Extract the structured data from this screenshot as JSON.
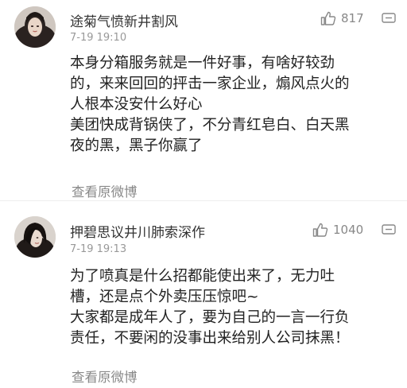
{
  "comments": [
    {
      "username": "途菊气愤新井割风",
      "timestamp": "7-19 19:10",
      "likes": "817",
      "lines": [
        "本身分箱服务就是一件好事，有啥好较劲",
        "的，来来回回的抨击一家企业，煽风点火的",
        "人根本没安什么好心",
        "美团快成背锅侠了，不分青红皂白、白天黑",
        "夜的黑，黑子你赢了"
      ],
      "view_link": "查看原微博"
    },
    {
      "username": "押碧思议井川肺索深作",
      "timestamp": "7-19 19:13",
      "likes": "1040",
      "lines": [
        "为了喷真是什么招都能使出来了，无力吐",
        "槽，还是点个外卖压压惊吧~",
        "大家都是成年人了，要为自己的一言一行负",
        "责任，不要闲的没事出来给别人公司抹黑！"
      ],
      "view_link": "查看原微博"
    }
  ],
  "icons": {
    "like": "thumbs-up-icon",
    "more": "comment-menu-icon"
  },
  "colors": {
    "text": "#222222",
    "meta": "#999999",
    "link": "#8a8a8a"
  }
}
